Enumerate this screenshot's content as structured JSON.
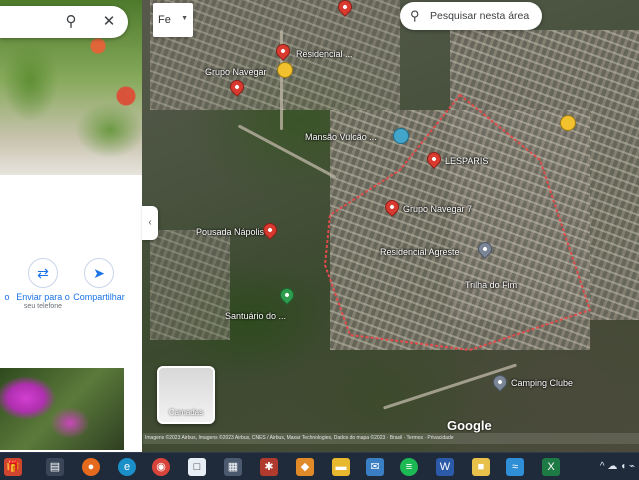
{
  "left_panel": {
    "search_close_icon": "close-icon",
    "search_icon": "search-icon",
    "actions": [
      {
        "label": "o",
        "sub": "",
        "icon": "partial-icon"
      },
      {
        "label": "Enviar para o",
        "sub": "seu telefone",
        "icon": "send-to-phone-icon"
      },
      {
        "label": "Compartilhar",
        "sub": "",
        "icon": "share-icon"
      }
    ],
    "collapse_glyph": "‹"
  },
  "map_controls": {
    "layer_select_label": "Fe",
    "search_area_label": "Pesquisar nesta área",
    "layers_label": "Camadas",
    "google_logo": "Google",
    "attribution": "Imagens ©2023 Airbus, Imagens ©2023 Airbus, CNES / Airbus, Maxar Technologies, Dados do mapa ©2023 · Brasil · Termos · Privacidade"
  },
  "places": [
    {
      "name": "Residencial ...",
      "type": "pin-red"
    },
    {
      "name": "Grupo Navegar",
      "type": "pin-red"
    },
    {
      "name": "Mansão Vulcão ...",
      "type": "star-blue"
    },
    {
      "name": "LESPARIS",
      "type": "pin-red"
    },
    {
      "name": "Grupo Navegar 7",
      "type": "pin-red"
    },
    {
      "name": "Pousada Nápolis",
      "type": "pin-red"
    },
    {
      "name": "Residencial Agreste",
      "type": "pin-gray"
    },
    {
      "name": "Trilha do Fim",
      "type": "text"
    },
    {
      "name": "Santuário do ...",
      "type": "pin-green"
    },
    {
      "name": "Camping Clube",
      "type": "pin-gray"
    }
  ],
  "taskbar": {
    "icons": [
      "gift-icon",
      "task-view-icon",
      "firefox-icon",
      "edge-icon",
      "chrome-icon",
      "file-icon",
      "calculator-icon",
      "app-red-icon",
      "app-orange-icon",
      "folder-icon",
      "mail-icon",
      "spotify-icon",
      "word-icon",
      "files-icon",
      "chart-icon",
      "excel-icon"
    ],
    "tray_glyphs": "^ ☁ ◖ ⌁"
  }
}
